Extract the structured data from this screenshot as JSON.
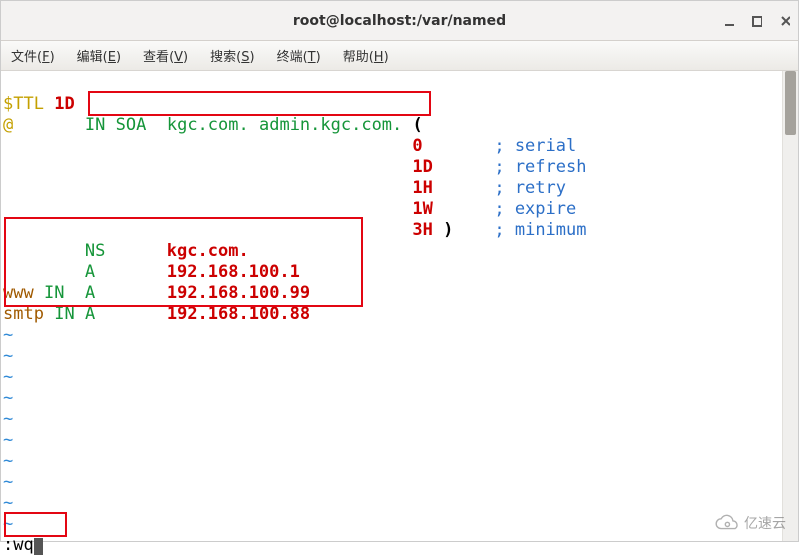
{
  "window": {
    "title": "root@localhost:/var/named"
  },
  "menu": {
    "file": {
      "label": "文件",
      "accel": "F"
    },
    "edit": {
      "label": "编辑",
      "accel": "E"
    },
    "view": {
      "label": "查看",
      "accel": "V"
    },
    "search": {
      "label": "搜索",
      "accel": "S"
    },
    "term": {
      "label": "终端",
      "accel": "T"
    },
    "help": {
      "label": "帮助",
      "accel": "H"
    }
  },
  "bind": {
    "ttl_keyword": "$TTL",
    "ttl_value": "1D",
    "at": "@",
    "kw_in": "IN",
    "soa": "SOA",
    "soa_origin": "kgc.com.",
    "soa_admin": "admin.kgc.com.",
    "open_paren": "(",
    "serial_val": "0",
    "serial_cmt": "serial",
    "refresh_val": "1D",
    "refresh_cmt": "refresh",
    "retry_val": "1H",
    "retry_cmt": "retry",
    "expire_val": "1W",
    "expire_cmt": "expire",
    "minimum_val": "3H",
    "minimum_cmt": "minimum",
    "close_paren": ")",
    "semi": ";",
    "ns_type": "NS",
    "ns_value": "kgc.com.",
    "a_type": "A",
    "a_root_ip": "192.168.100.1",
    "www_host": "www",
    "www_ip": "192.168.100.99",
    "smtp_host": "smtp",
    "smtp_ip": "192.168.100.88",
    "tilde": "~"
  },
  "cmd": {
    "prefix": ":",
    "text": "wq"
  },
  "watermark": "亿速云"
}
